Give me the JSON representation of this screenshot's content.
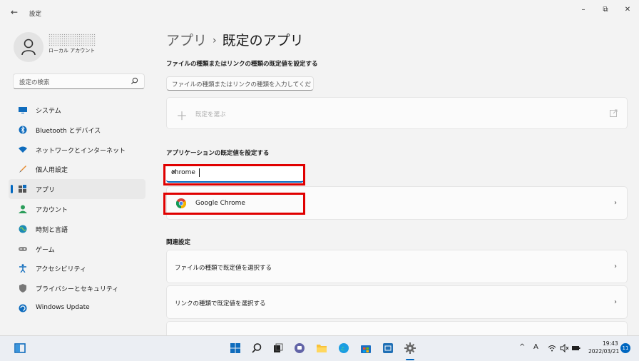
{
  "window": {
    "title": "設定",
    "back_icon": "arrow-left-icon",
    "minimize": "–",
    "restore": "⧉",
    "close": "✕"
  },
  "account": {
    "type": "ローカル アカウント"
  },
  "search": {
    "placeholder": "設定の検索"
  },
  "sidebar": {
    "items": [
      {
        "label": "システム",
        "icon": "monitor-icon"
      },
      {
        "label": "Bluetooth とデバイス",
        "icon": "bluetooth-icon"
      },
      {
        "label": "ネットワークとインターネット",
        "icon": "wifi-icon"
      },
      {
        "label": "個人用設定",
        "icon": "brush-icon"
      },
      {
        "label": "アプリ",
        "icon": "apps-icon",
        "active": true
      },
      {
        "label": "アカウント",
        "icon": "person-icon"
      },
      {
        "label": "時刻と言語",
        "icon": "globe-clock-icon"
      },
      {
        "label": "ゲーム",
        "icon": "gamepad-icon"
      },
      {
        "label": "アクセシビリティ",
        "icon": "accessibility-icon"
      },
      {
        "label": "プライバシーとセキュリティ",
        "icon": "shield-icon"
      },
      {
        "label": "Windows Update",
        "icon": "update-icon"
      }
    ]
  },
  "main": {
    "breadcrumb_parent": "アプリ",
    "breadcrumb_sep": "›",
    "breadcrumb_current": "既定のアプリ",
    "filetype_section": "ファイルの種類またはリンクの種類の既定値を設定する",
    "filetype_placeholder": "ファイルの種類またはリンクの種類を入力してください",
    "choose_default": "既定を選ぶ",
    "app_section": "アプリケーションの既定値を設定する",
    "app_search_value": "chrome",
    "app_result": "Google Chrome",
    "related_title": "関連設定",
    "related": [
      "ファイルの種類で既定値を選択する",
      "リンクの種類で既定値を選択する"
    ]
  },
  "taskbar": {
    "time": "19:43",
    "date": "2022/03/21",
    "ime": "A",
    "notifications": "11",
    "tray_chevron": "^"
  },
  "colors": {
    "accent": "#0067c0",
    "highlight_box": "#e00000"
  }
}
